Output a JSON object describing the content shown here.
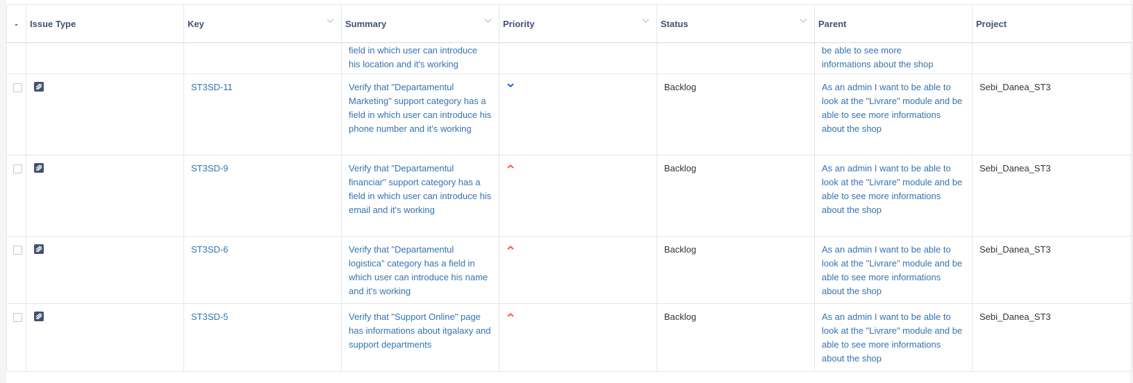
{
  "columns": {
    "select": "-",
    "issue_type": "Issue Type",
    "key": "Key",
    "summary": "Summary",
    "priority": "Priority",
    "status": "Status",
    "parent": "Parent",
    "project": "Project"
  },
  "partial_row": {
    "summary_line1": "field in which user can introduce",
    "summary_line2": "his location and it's working",
    "parent_line1": "be able to see more",
    "parent_line2": "informations about the shop"
  },
  "rows": [
    {
      "issue_type_icon": "task-icon",
      "key": "ST3SD-11",
      "summary": "Verify that \"Departamentul Marketing\" support category has a field in which user can introduce his phone number and it's working",
      "priority": "low",
      "status": "Backlog",
      "parent": "As an admin I want to be able to look at the \"Livrare\" module and be able to see more informations about the shop",
      "project": "Sebi_Danea_ST3"
    },
    {
      "issue_type_icon": "task-icon",
      "key": "ST3SD-9",
      "summary": "Verify that \"Departamentul financiar\" support category has a field in which user can introduce his email and it's working",
      "priority": "high",
      "status": "Backlog",
      "parent": "As an admin I want to be able to look at the \"Livrare\" module and be able to see more informations about the shop",
      "project": "Sebi_Danea_ST3"
    },
    {
      "issue_type_icon": "task-icon",
      "key": "ST3SD-6",
      "summary": "Verify that \"Departamentul logistica\" category has a field in which user can introduce his name and it's working",
      "priority": "high",
      "status": "Backlog",
      "parent": "As an admin I want to be able to look at the \"Livrare\" module and be able to see more informations about the shop",
      "project": "Sebi_Danea_ST3"
    },
    {
      "issue_type_icon": "task-icon",
      "key": "ST3SD-5",
      "summary": "Verify that \"Support Online\" page has informations about itgalaxy and support departments",
      "priority": "high",
      "status": "Backlog",
      "parent": "As an admin I want to be able to look at the \"Livrare\" module and be able to see more informations about the shop",
      "project": "Sebi_Danea_ST3"
    }
  ],
  "colors": {
    "link": "#3572b0",
    "priority_low": "#0065ff",
    "priority_high": "#ff5630",
    "issue_icon": "#42526e"
  }
}
